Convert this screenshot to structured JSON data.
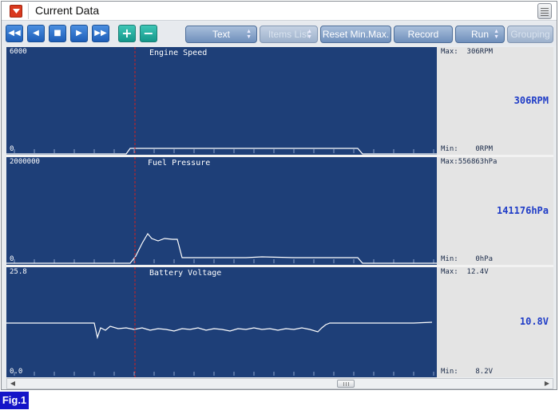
{
  "window": {
    "title": "Current Data"
  },
  "toolbar": {
    "nav_buttons": [
      {
        "name": "rewind",
        "glyph": "◀◀"
      },
      {
        "name": "step-back",
        "glyph": "◀"
      },
      {
        "name": "stop",
        "glyph": "■"
      },
      {
        "name": "play",
        "glyph": "▶"
      },
      {
        "name": "fast-forward",
        "glyph": "▶▶"
      },
      {
        "name": "zoom-in",
        "glyph": "+"
      },
      {
        "name": "zoom-out",
        "glyph": "−"
      }
    ],
    "text_label": "Text",
    "items_list_label": "Items List",
    "reset_label": "Reset Min.Max.",
    "record_label": "Record",
    "run_label": "Run",
    "grouping_label": "Grouping"
  },
  "graphs": [
    {
      "title": "Engine Speed",
      "axis_max": "6000",
      "axis_min": "0",
      "max_label": "Max:",
      "max_value": "306RPM",
      "min_label": "Min:",
      "min_value": "0RPM",
      "current": "306RPM"
    },
    {
      "title": "Fuel Pressure",
      "axis_max": "2000000",
      "axis_min": "0",
      "max_label": "Max:",
      "max_value": "556863hPa",
      "min_label": "Min:",
      "min_value": "0hPa",
      "current": "141176hPa"
    },
    {
      "title": "Battery Voltage",
      "axis_max": "25.8",
      "axis_min": "0.0",
      "max_label": "Max:",
      "max_value": "12.4V",
      "min_label": "Min:",
      "min_value": "8.2V",
      "current": "10.8V"
    }
  ],
  "figure_label": "Fig.1",
  "colors": {
    "graph_bg": "#1e3f78",
    "trace": "#ffffff",
    "cursor": "#d02020",
    "current_value": "#1f3cc7",
    "figure_badge": "#1515c8"
  }
}
